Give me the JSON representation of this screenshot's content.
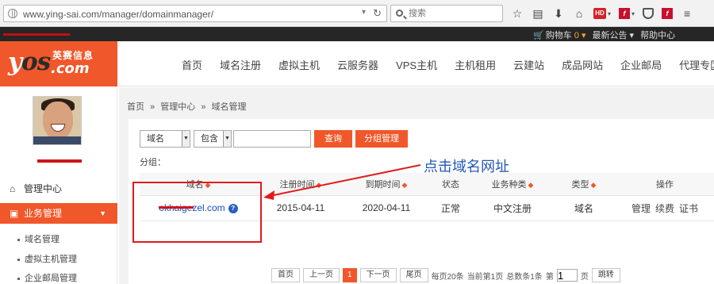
{
  "browser": {
    "url": "www.ying-sai.com/manager/domainmanager/",
    "search_placeholder": "搜索",
    "toolbar_icons": [
      "star-icon",
      "reading-list-icon",
      "download-icon",
      "home-icon",
      "extension-badge-icon",
      "flash-icon",
      "pocket-icon",
      "flash-plugin-icon",
      "menu-icon"
    ],
    "badge_text": "HD"
  },
  "topbar": {
    "cart_label": "购物车",
    "cart_count": "0",
    "notice_label": "最新公告",
    "help_label": "帮助中心"
  },
  "logo": {
    "mark_y": "y",
    "mark_os": "os",
    "cn": "英赛信息",
    "com": ".com"
  },
  "nav": {
    "items": [
      "首页",
      "域名注册",
      "虚拟主机",
      "云服务器",
      "VPS主机",
      "主机租用",
      "云建站",
      "成品网站",
      "企业邮局",
      "代理专区"
    ]
  },
  "sidebar": {
    "home_label": "管理中心",
    "active_label": "业务管理",
    "sub_items": [
      "域名管理",
      "虚拟主机管理",
      "企业邮局管理"
    ]
  },
  "breadcrumb": {
    "items": [
      "首页",
      "管理中心",
      "域名管理"
    ],
    "sep": "»"
  },
  "filter": {
    "type_select": "域名",
    "match_select": "包含",
    "search_button": "查询",
    "group_button": "分组管理",
    "group_label": "分组："
  },
  "table": {
    "headers": [
      "域名",
      "注册时间",
      "到期时间",
      "状态",
      "业务种类",
      "类型",
      "操作"
    ],
    "rows": [
      {
        "domain": "okhaigezel.com",
        "reg_date": "2015-04-11",
        "exp_date": "2020-04-11",
        "status": "正常",
        "kind": "中文注册",
        "type": "域名",
        "ops": [
          "管理",
          "续费",
          "证书"
        ]
      }
    ]
  },
  "pager": {
    "first": "首页",
    "prev": "上一页",
    "current": "1",
    "next": "下一页",
    "last": "尾页",
    "per_page": "每页20条",
    "current_page": "当前第1页",
    "total": "总数条1条",
    "goto_prefix": "第",
    "goto_value": "1",
    "goto_suffix": "页",
    "jump": "跳转"
  },
  "annotation": {
    "text": "点击域名网址",
    "color": "#2458b3",
    "box_color": "#e11b1b"
  },
  "colors": {
    "accent": "#f0572a",
    "topbar": "#262626",
    "link": "#1a4fc0"
  }
}
